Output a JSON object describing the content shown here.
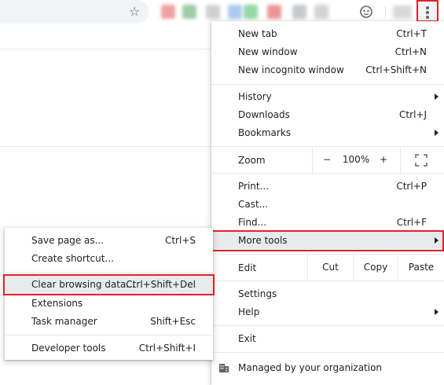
{
  "toolbar": {
    "icons": [
      "star-icon",
      "face-icon",
      "more-vert-icon"
    ]
  },
  "main_menu": {
    "new_tab": {
      "label": "New tab",
      "shortcut": "Ctrl+T"
    },
    "new_window": {
      "label": "New window",
      "shortcut": "Ctrl+N"
    },
    "new_incognito": {
      "label": "New incognito window",
      "shortcut": "Ctrl+Shift+N"
    },
    "history": {
      "label": "History"
    },
    "downloads": {
      "label": "Downloads",
      "shortcut": "Ctrl+J"
    },
    "bookmarks": {
      "label": "Bookmarks"
    },
    "zoom": {
      "label": "Zoom",
      "minus": "−",
      "value": "100%",
      "plus": "+"
    },
    "print": {
      "label": "Print...",
      "shortcut": "Ctrl+P"
    },
    "cast": {
      "label": "Cast..."
    },
    "find": {
      "label": "Find...",
      "shortcut": "Ctrl+F"
    },
    "more_tools": {
      "label": "More tools"
    },
    "edit": {
      "label": "Edit",
      "cut": "Cut",
      "copy": "Copy",
      "paste": "Paste"
    },
    "settings": {
      "label": "Settings"
    },
    "help": {
      "label": "Help"
    },
    "exit": {
      "label": "Exit"
    },
    "managed": {
      "label": "Managed by your organization"
    }
  },
  "submenu": {
    "save_page": {
      "label": "Save page as...",
      "shortcut": "Ctrl+S"
    },
    "create_shortcut": {
      "label": "Create shortcut..."
    },
    "clear_data": {
      "label": "Clear browsing data...",
      "shortcut": "Ctrl+Shift+Del"
    },
    "extensions": {
      "label": "Extensions"
    },
    "task_manager": {
      "label": "Task manager",
      "shortcut": "Shift+Esc"
    },
    "developer_tools": {
      "label": "Developer tools",
      "shortcut": "Ctrl+Shift+I"
    }
  },
  "colors": {
    "highlight": "#e8eaed",
    "annotation_red": "#e0242a"
  }
}
